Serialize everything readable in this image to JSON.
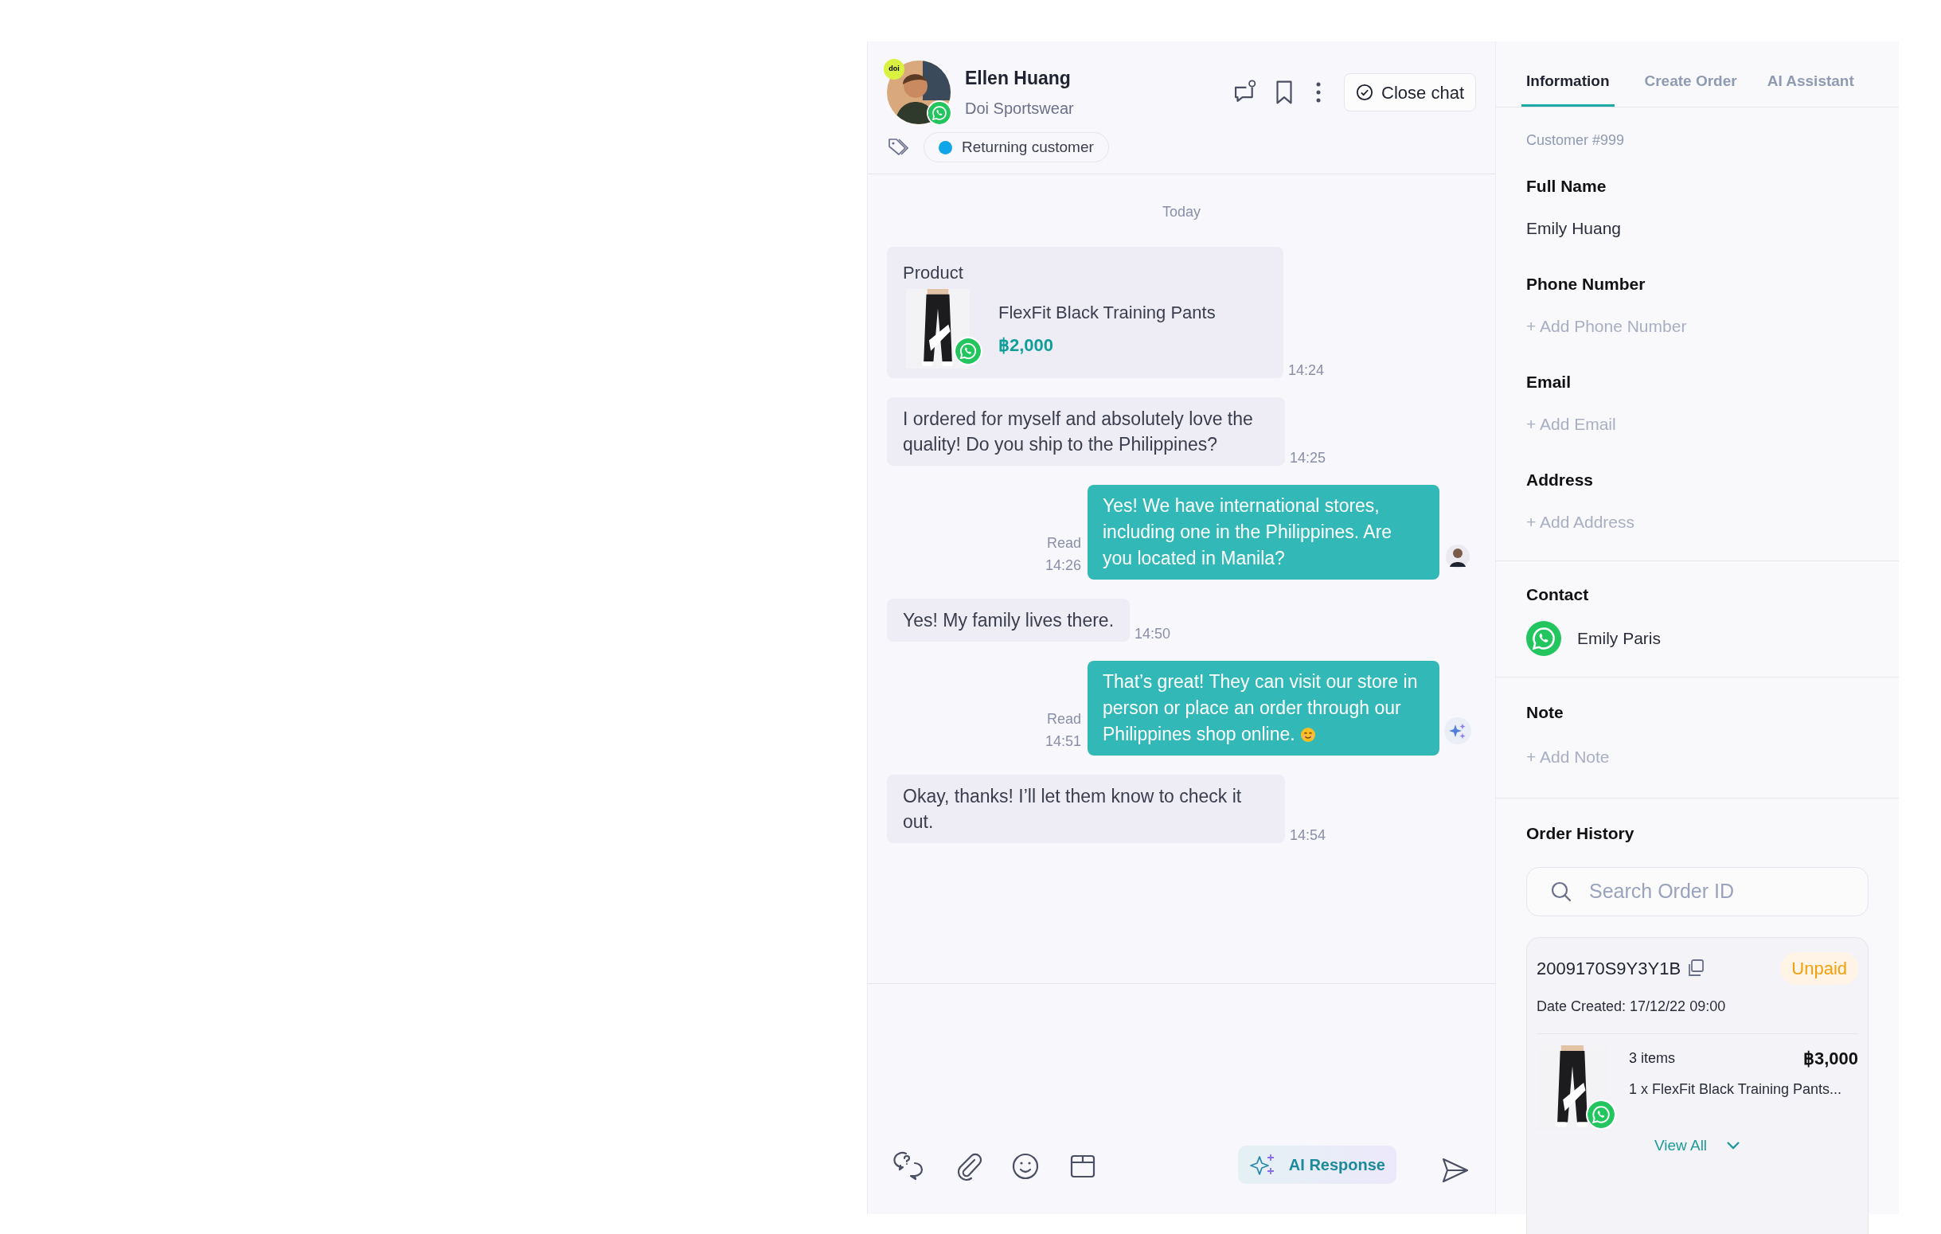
{
  "chat_header": {
    "name": "Ellen Huang",
    "company": "Doi Sportswear",
    "brand_badge": "doi",
    "close_button": "Close chat",
    "tags": [
      {
        "label": "Returning customer",
        "color": "#0ea5e9"
      }
    ]
  },
  "date_divider": "Today",
  "messages": [
    {
      "kind": "product",
      "title": "Product",
      "name": "FlexFit Black Training Pants",
      "price": "฿2,000",
      "time": "14:24"
    },
    {
      "kind": "incoming",
      "text": "I ordered for myself and absolutely love the quality! Do you ship to the Philippines?",
      "time": "14:25"
    },
    {
      "kind": "outgoing",
      "text": "Yes! We have international stores, including one in the Philippines. Are you located in Manila?",
      "status": "Read",
      "time": "14:26",
      "ai_generated": false
    },
    {
      "kind": "incoming",
      "text": "Yes! My family lives there.",
      "time": "14:50"
    },
    {
      "kind": "outgoing",
      "text": "That’s great! They can visit our store in person or place an order through our Philippines shop online.",
      "emoji": true,
      "status": "Read",
      "time": "14:51",
      "ai_generated": true
    },
    {
      "kind": "incoming",
      "text": "Okay, thanks! I’ll let them know to check it out.",
      "time": "14:54"
    }
  ],
  "composer": {
    "ai_button": "AI Response"
  },
  "side_panel": {
    "tabs": [
      {
        "label": "Information",
        "selected": true
      },
      {
        "label": "Create Order",
        "selected": false
      },
      {
        "label": "AI Assistant",
        "selected": false
      }
    ],
    "customer_id": "Customer #999",
    "fields": [
      {
        "label": "Full Name",
        "value": "Emily Huang"
      },
      {
        "label": "Phone Number",
        "add_link": "+ Add Phone Number"
      },
      {
        "label": "Email",
        "add_link": "+ Add Email"
      },
      {
        "label": "Address",
        "add_link": "+ Add Address"
      }
    ],
    "contact": {
      "title": "Contact",
      "name": "Emily Paris"
    },
    "note": {
      "title": "Note",
      "add_link": "+ Add Note"
    },
    "order_history": {
      "title": "Order History",
      "search": {
        "placeholder": "Search Order ID"
      },
      "order": {
        "id": "2009170S9Y3Y1B",
        "status": "Unpaid",
        "date": "Date Created: 17/12/22 09:00",
        "items_count": "3 items",
        "total": "฿3,000",
        "item": "1 x FlexFit Black Training Pants...",
        "view_all": "View All"
      }
    }
  }
}
